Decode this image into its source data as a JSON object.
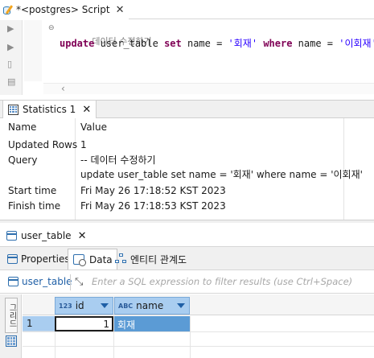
{
  "editor_tab": {
    "title": "*<postgres> Script",
    "close": "✕"
  },
  "editor": {
    "comment": "-- 데이터 수정하기",
    "sql_tokens": [
      {
        "t": "update",
        "k": "kw"
      },
      {
        "t": " user_table ",
        "k": "plain"
      },
      {
        "t": "set",
        "k": "kw"
      },
      {
        "t": " name = ",
        "k": "plain"
      },
      {
        "t": "'회재'",
        "k": "str"
      },
      {
        "t": " ",
        "k": "plain"
      },
      {
        "t": "where",
        "k": "kw"
      },
      {
        "t": " name = ",
        "k": "plain"
      },
      {
        "t": "'이회재'",
        "k": "str"
      },
      {
        "t": ";",
        "k": "plain"
      }
    ],
    "gutter_icons": [
      "run-icon",
      "run-script-icon",
      "explain-icon",
      "history-icon"
    ]
  },
  "stats_tab": {
    "title": "Statistics 1",
    "close": "✕"
  },
  "stats": {
    "header": {
      "name": "Name",
      "value": "Value"
    },
    "rows": [
      {
        "name": "Updated Rows",
        "value": "1"
      },
      {
        "name": "Query",
        "value": "-- 데이터 수정하기"
      },
      {
        "name": "",
        "value": "update user_table set name = '회재' where name = '이회재'"
      },
      {
        "name": "Start time",
        "value": "Fri May 26 17:18:52 KST 2023"
      },
      {
        "name": "Finish time",
        "value": "Fri May 26 17:18:53 KST 2023"
      }
    ]
  },
  "table_tab": {
    "title": "user_table",
    "close": "✕"
  },
  "subtabs": {
    "properties": "Properties",
    "data": "Data",
    "er": "엔티티 관계도",
    "active": "data"
  },
  "filter": {
    "source": "user_table",
    "placeholder": "Enter a SQL expression to filter results (use Ctrl+Space)"
  },
  "results": {
    "side_label": "그리드",
    "columns": [
      {
        "type_badge": "123",
        "name": "id"
      },
      {
        "type_badge": "ABC",
        "name": "name"
      }
    ],
    "rows": [
      {
        "row_no": "1",
        "id": "1",
        "name": "회재"
      }
    ]
  }
}
